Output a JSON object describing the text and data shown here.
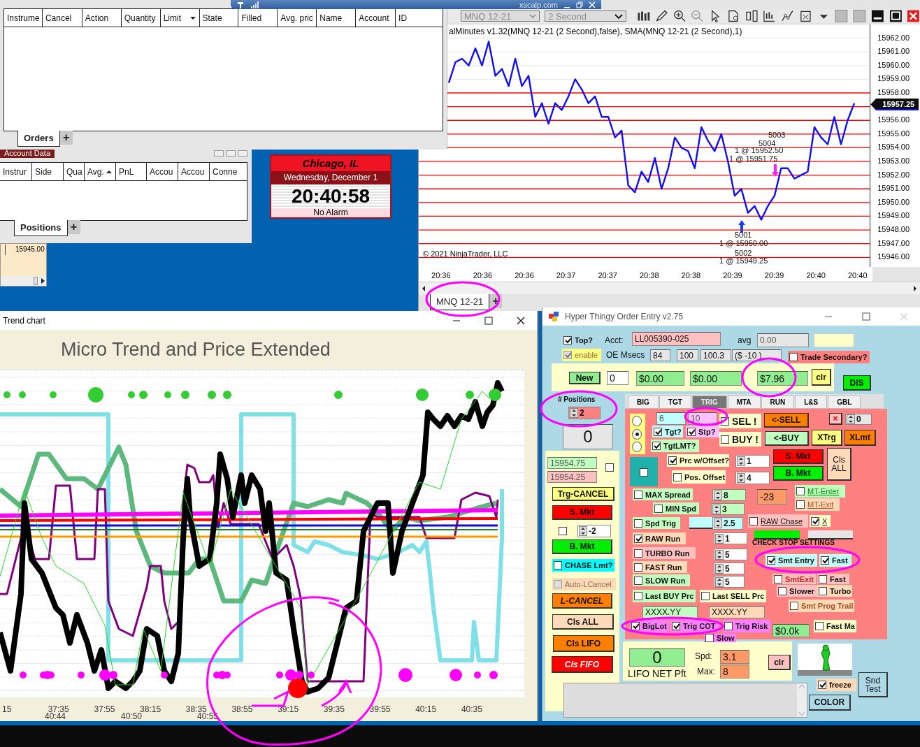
{
  "banner": {
    "site": "xscalp.com"
  },
  "orders_panel": {
    "columns": [
      "Instrume",
      "Cancel",
      "Action",
      "Quantity",
      "Limit",
      "State",
      "Filled",
      "Avg. pric",
      "Name",
      "Account",
      "ID"
    ],
    "tabs": [
      {
        "label": "Orders",
        "selected": true
      }
    ],
    "add_tab": "+"
  },
  "account_data": {
    "title": "Account Data",
    "columns": [
      "Instrur",
      "Side",
      "Qua",
      "Avg.",
      "PnL",
      "Accou",
      "Accou",
      "Conne"
    ],
    "tabs": [
      {
        "label": "Positions",
        "selected": true
      }
    ],
    "add_tab": "+"
  },
  "price_ladder": {
    "price": "15945.00"
  },
  "clock": {
    "city": "Chicago, IL",
    "date": "Wednesday, December 1",
    "time": "20:40:58",
    "alarm": "No Alarm"
  },
  "price_chart": {
    "instrument": "MNQ 12-21",
    "interval": "2 Second",
    "indicator_label": "alMinutes v1.32(MNQ 12-21 (2 Second),false), SMA(MNQ 12-21 (2 Second),1)",
    "copyright": "© 2021 NinjaTrader, LLC",
    "last_price": "15957.25",
    "trade_marks": [
      {
        "label": "5003"
      },
      {
        "label": "5004"
      },
      {
        "label": "1 @ 15952.50"
      },
      {
        "label": "1 @ 15951.75"
      },
      {
        "label": "5001"
      },
      {
        "label": "1 @ 15950.00"
      },
      {
        "label": "5002"
      },
      {
        "label": "1 @ 15949.25"
      }
    ],
    "time_labels": [
      "20:36",
      "20:36",
      "20:36",
      "20:37",
      "20:37",
      "20:38",
      "20:38",
      "20:39",
      "20:39",
      "20:40",
      "20:40"
    ],
    "chart_data": {
      "type": "line",
      "ylim": [
        15945.3,
        15963
      ],
      "yticks": [
        {
          "value": 15962,
          "label": "15962.00"
        },
        {
          "value": 15961,
          "label": "15961.00"
        },
        {
          "value": 15960,
          "label": "15960.00"
        },
        {
          "value": 15959,
          "label": "15959.00"
        },
        {
          "value": 15958,
          "label": "15958.00"
        },
        {
          "value": 15956,
          "label": "15956.00"
        },
        {
          "value": 15955,
          "label": "15955.00"
        },
        {
          "value": 15954,
          "label": "15954.00"
        },
        {
          "value": 15953,
          "label": "15953.00"
        },
        {
          "value": 15952,
          "label": "15952.00"
        },
        {
          "value": 15951,
          "label": "15951.00"
        },
        {
          "value": 15950,
          "label": "15950.00"
        },
        {
          "value": 15949,
          "label": "15949.00"
        },
        {
          "value": 15948,
          "label": "15948.00"
        },
        {
          "value": 15947,
          "label": "15947.00"
        },
        {
          "value": 15946,
          "label": "15946.00"
        }
      ],
      "series": [
        {
          "color": "#1010ee",
          "values": [
            15958.75,
            15960.25,
            15960.5,
            15960,
            15961.25,
            15960,
            15961.75,
            15959.25,
            15959.75,
            15958.5,
            15960.5,
            15958.5,
            15959.25,
            15956.25,
            15957.25,
            15955.75,
            15957.25,
            15956.75,
            15957.75,
            15959,
            15958.25,
            15957.25,
            15957.75,
            15956.25,
            15956.25,
            15954.75,
            15955.25,
            15951.25,
            15950.75,
            15952.25,
            15951.5,
            15953.25,
            15951,
            15952.5,
            15954.75,
            15954,
            15953.75,
            15952.5,
            15955.5,
            15954.5,
            15953.75,
            15955,
            15953,
            15950.5,
            15951,
            15949.25,
            15949.75,
            15948.75,
            15949.75,
            15950.5,
            15952.5,
            15952.5,
            15951.75,
            15952,
            15952.25,
            15955.5,
            15954.75,
            15954.25,
            15956.25,
            15954.25,
            15956,
            15957.25
          ]
        }
      ],
      "grid": true
    },
    "tabs": [
      {
        "label": "MNQ 12-21",
        "selected": true
      }
    ],
    "add_tab": "+"
  },
  "trend_chart": {
    "title": "Trend chart",
    "heading": "Micro Trend and Price Extended",
    "time_labels": [
      "15",
      "37:35",
      "37:55",
      "38:15",
      "38:35",
      "38:55",
      "39:15",
      "39:35",
      "39:55",
      "40:15",
      "40:35"
    ],
    "time_labels_lower": [
      "40:44",
      "40:50",
      "40:55"
    ]
  },
  "order_entry": {
    "title": "Hyper Thingy Order Entry v2.75",
    "tabs": [
      {
        "label": "BIG",
        "selected": false
      },
      {
        "label": "TGT",
        "selected": false
      },
      {
        "label": "TRIG",
        "selected": true
      },
      {
        "label": "MTA",
        "selected": false
      },
      {
        "label": "RUN",
        "selected": false
      },
      {
        "label": "L&S",
        "selected": false
      },
      {
        "label": "GBL",
        "selected": false
      }
    ],
    "controls": [
      {
        "kind": "checkbox",
        "label": "Top?",
        "checked": true
      },
      {
        "kind": "label",
        "text": "Acct:"
      },
      {
        "kind": "field",
        "value": "LL005390-025"
      },
      {
        "kind": "label",
        "text": "avg"
      },
      {
        "kind": "field",
        "value": "0.00"
      },
      {
        "kind": "checkbox",
        "label": "enable",
        "checked": true,
        "disabled": true
      },
      {
        "kind": "label",
        "text": "OE Msecs"
      },
      {
        "kind": "field",
        "value": "84"
      },
      {
        "kind": "field",
        "value": "100"
      },
      {
        "kind": "field",
        "value": "100.3"
      },
      {
        "kind": "field",
        "value": "($ -10 )"
      },
      {
        "kind": "checkbox",
        "label": "Trade Secondary?",
        "checked": false
      },
      {
        "kind": "button",
        "label": "New"
      },
      {
        "kind": "field",
        "value": "0"
      },
      {
        "kind": "field",
        "value": "$0.00"
      },
      {
        "kind": "field",
        "value": "$0.00"
      },
      {
        "kind": "field",
        "value": "$7.96"
      },
      {
        "kind": "button",
        "label": "clr"
      },
      {
        "kind": "button",
        "label": "DIS"
      },
      {
        "kind": "label",
        "text": "# Positions"
      },
      {
        "kind": "spinner",
        "value": "2"
      },
      {
        "kind": "field",
        "value": "0"
      },
      {
        "kind": "field",
        "value": "15954.75"
      },
      {
        "kind": "field",
        "value": "15954.25"
      },
      {
        "kind": "checkbox",
        "checked": false
      },
      {
        "kind": "button",
        "label": "Trg-CANCEL"
      },
      {
        "kind": "button",
        "label": "S. Mkt"
      },
      {
        "kind": "checkbox",
        "checked": false
      },
      {
        "kind": "spinner",
        "value": "-2"
      },
      {
        "kind": "button",
        "label": "B. Mkt"
      },
      {
        "kind": "checkbox",
        "label": "CHASE Lmt?",
        "checked": false
      },
      {
        "kind": "checkbox",
        "label": "Auto-LCancel",
        "checked": false,
        "disabled": true
      },
      {
        "kind": "button",
        "label": "L-CANCEL"
      },
      {
        "kind": "button",
        "label": "Cls ALL"
      },
      {
        "kind": "button",
        "label": "Cls LIFO"
      },
      {
        "kind": "button",
        "label": "Cls FIFO"
      },
      {
        "kind": "radio",
        "selected": false
      },
      {
        "kind": "radio",
        "selected": true
      },
      {
        "kind": "radio",
        "selected": false
      },
      {
        "kind": "field",
        "value": "6"
      },
      {
        "kind": "field",
        "value": "10"
      },
      {
        "kind": "checkbox",
        "label": "Tgt?",
        "checked": true
      },
      {
        "kind": "checkbox",
        "label": "Stp?",
        "checked": true
      },
      {
        "kind": "checkbox",
        "label": "TgtLMT?",
        "checked": true
      },
      {
        "kind": "checkbox",
        "label": "SEL !",
        "checked": false
      },
      {
        "kind": "checkbox",
        "label": "BUY !",
        "checked": false
      },
      {
        "kind": "button",
        "label": "<-SELL"
      },
      {
        "kind": "button",
        "label": "<-BUY"
      },
      {
        "kind": "button",
        "label": "XTrg"
      },
      {
        "kind": "button",
        "label": "XLmt"
      },
      {
        "kind": "button",
        "label": "×"
      },
      {
        "kind": "spinner",
        "value": "0"
      },
      {
        "kind": "checkbox",
        "checked": false
      },
      {
        "kind": "checkbox",
        "label": "Prc w/Offset?",
        "checked": true
      },
      {
        "kind": "checkbox",
        "label": "Pos. Offset",
        "checked": false
      },
      {
        "kind": "spinner",
        "value": "1"
      },
      {
        "kind": "spinner",
        "value": "4"
      },
      {
        "kind": "button",
        "label": "S. Mkt"
      },
      {
        "kind": "button",
        "label": "B. Mkt"
      },
      {
        "kind": "button",
        "label": "Cls ALL"
      },
      {
        "kind": "checkbox",
        "label": "MAX Spread",
        "checked": false
      },
      {
        "kind": "checkbox",
        "label": "MIN Spd",
        "checked": false
      },
      {
        "kind": "checkbox",
        "label": "Spd Trig",
        "checked": false
      },
      {
        "kind": "spinner",
        "value": "8"
      },
      {
        "kind": "spinner",
        "value": "3"
      },
      {
        "kind": "spinner",
        "value": "2.5"
      },
      {
        "kind": "field",
        "value": "-23"
      },
      {
        "kind": "checkbox",
        "label": "MT-Enter",
        "checked": false,
        "link": true
      },
      {
        "kind": "checkbox",
        "label": "MT-Exit",
        "checked": false,
        "link": true
      },
      {
        "kind": "checkbox",
        "label": "RAW Chase",
        "checked": false,
        "link": true
      },
      {
        "kind": "checkbox",
        "label": "X",
        "checked": true,
        "link": true
      },
      {
        "kind": "label",
        "text": "CHECK STOP SETTINGS"
      },
      {
        "kind": "checkbox",
        "label": "RAW Run",
        "checked": true
      },
      {
        "kind": "checkbox",
        "label": "TURBO Run",
        "checked": false
      },
      {
        "kind": "checkbox",
        "label": "FAST Run",
        "checked": false
      },
      {
        "kind": "checkbox",
        "label": "SLOW Run",
        "checked": false
      },
      {
        "kind": "checkbox",
        "label": "Last BUY Prc",
        "checked": false
      },
      {
        "kind": "checkbox",
        "label": "Last SELL Prc",
        "checked": false
      },
      {
        "kind": "spinner",
        "value": "1"
      },
      {
        "kind": "spinner",
        "value": "5"
      },
      {
        "kind": "spinner",
        "value": "5"
      },
      {
        "kind": "spinner",
        "value": "5"
      },
      {
        "kind": "checkbox",
        "label": "Smt Entry",
        "checked": true
      },
      {
        "kind": "checkbox",
        "label": "Fast",
        "checked": true
      },
      {
        "kind": "checkbox",
        "label": "SmtExit",
        "checked": false
      },
      {
        "kind": "checkbox",
        "label": "Fast",
        "checked": false
      },
      {
        "kind": "checkbox",
        "label": "Slower",
        "checked": false
      },
      {
        "kind": "checkbox",
        "label": "Turbo",
        "checked": false
      },
      {
        "kind": "checkbox",
        "label": "Smt Prog Trail",
        "checked": false
      },
      {
        "kind": "field",
        "value": "XXXX.YY"
      },
      {
        "kind": "field",
        "value": "XXXX.YY"
      },
      {
        "kind": "checkbox",
        "label": "BigLot",
        "checked": true
      },
      {
        "kind": "checkbox",
        "label": "Trig COT",
        "checked": true
      },
      {
        "kind": "checkbox",
        "label": "Trig Risk",
        "checked": false
      },
      {
        "kind": "checkbox",
        "label": "Slow",
        "checked": false
      },
      {
        "kind": "field",
        "value": "$0.0k"
      },
      {
        "kind": "checkbox",
        "label": "Fast Ma",
        "checked": false
      },
      {
        "kind": "field",
        "value": "0"
      },
      {
        "kind": "label",
        "text": "LIFO NET Pft"
      },
      {
        "kind": "label",
        "text": "Spd:"
      },
      {
        "kind": "label",
        "text": "Max:"
      },
      {
        "kind": "field",
        "value": "3.1"
      },
      {
        "kind": "field",
        "value": "8"
      },
      {
        "kind": "button",
        "label": "clr"
      },
      {
        "kind": "checkbox",
        "label": "freeze",
        "checked": true
      },
      {
        "kind": "button",
        "label": "Snd Test"
      },
      {
        "kind": "button",
        "label": "COLOR"
      }
    ]
  }
}
